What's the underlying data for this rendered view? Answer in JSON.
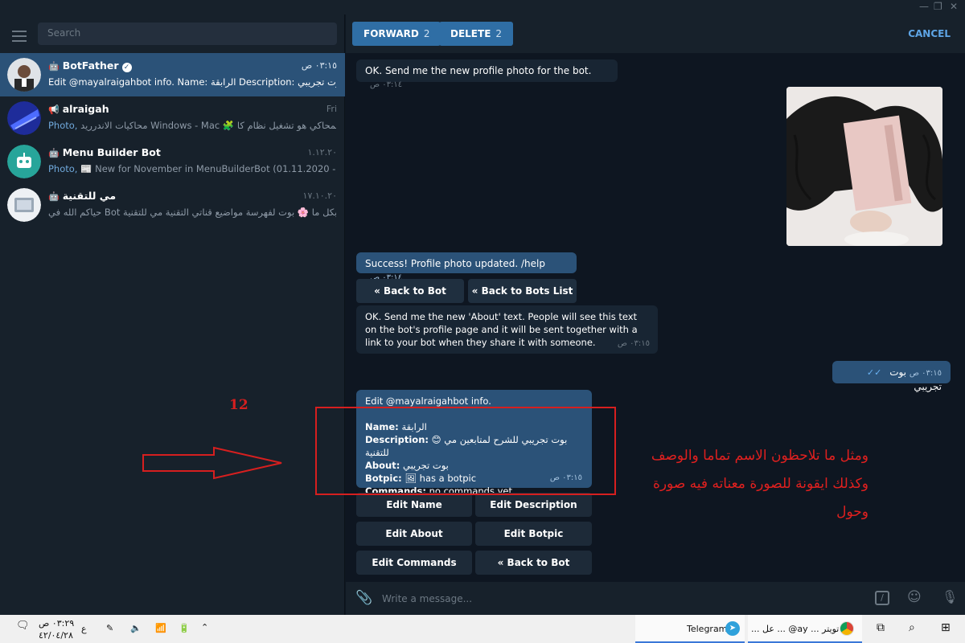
{
  "sidebar": {
    "search_placeholder": "Search",
    "chats": [
      {
        "title": "BotFather",
        "time": "٠٣:١٥ ص",
        "preview_prefix": "",
        "preview": "Edit @mayalraigahbot info.  Name: الرابقة Description:  بوت تجريبي"
      },
      {
        "title": "alraigah",
        "time": "Fri",
        "preview_prefix": "Photo,",
        "preview": "محاكيات الاندرريد Windows - Mac 🧩 المحاكي هو تشغيل نظام كا..."
      },
      {
        "title": "Menu Builder Bot",
        "time": "١.١٢.٢٠",
        "preview_prefix": "Photo,",
        "preview": "📰 New for November in MenuBuilderBot (01.11.2020 - 0..."
      },
      {
        "title": "مي للتقنية",
        "time": "١٧.١٠.٢٠",
        "preview_prefix": "",
        "preview": "حياكم الله في Bot بكل ما  🌸 بوت لفهرسة مواضيع قناتي التقنية  مي للتقنية..."
      }
    ]
  },
  "topbar": {
    "forward_label": "FORWARD",
    "forward_count": "2",
    "delete_label": "DELETE",
    "delete_count": "2",
    "cancel_label": "CANCEL"
  },
  "messages": {
    "m1_text": "OK. Send me the new profile photo for the bot.",
    "m1_time": "٠٣:١٤ ص",
    "m2_text": "Success! Profile photo updated. /help",
    "m2_time": "٠٣:١٤ ص",
    "m3_text": "OK. Send me the new 'About' text. People will see this text on the bot's profile page and it will be sent together with a link to your bot when they share it with someone.",
    "m3_time": "٠٣:١٥ ص",
    "m4_text": "بوت تجريبي",
    "m4_time": "٠٣:١٥ ص",
    "info_line1": "Edit @mayalraigahbot info.",
    "info_name_label": "Name:",
    "info_name": "الرابقة",
    "info_desc_label": "Description:",
    "info_desc": "😊 بوت تجريبي للشرح لمتابعين مي للتقنية",
    "info_about_label": "About:",
    "info_about": "بوت تجريبي",
    "info_botpic_label": "Botpic:",
    "info_botpic": "🖼 has a botpic",
    "info_cmd_label": "Commands:",
    "info_cmd": "no commands yet",
    "info_time": "٠٣:١٥ ص"
  },
  "buttons": {
    "back_to_bot": "« Back to Bot",
    "back_to_bots_list": "« Back to Bots List",
    "edit_name": "Edit Name",
    "edit_description": "Edit Description",
    "edit_about": "Edit About",
    "edit_botpic": "Edit Botpic",
    "edit_commands": "Edit Commands",
    "back_to_bot_2": "« Back to Bot"
  },
  "composer": {
    "placeholder": "Write a message..."
  },
  "annotation": {
    "number": "12",
    "text": "ومثل ما تلاحظون الاسم تماما والوصف وكذلك ايقونة للصورة معناته فيه صورة وحول",
    "color": "#d61f1f"
  },
  "taskbar": {
    "time": "٠٣:٢٩ ص",
    "date": "٤٢/٠٤/٢٨",
    "lang": "ع",
    "app1": "Telegram",
    "app2": "... عل ... @ay ... تويتر"
  },
  "colors": {
    "accent": "#2b5278",
    "button_blue": "#2f6ea5",
    "link": "#5ea5e6"
  }
}
